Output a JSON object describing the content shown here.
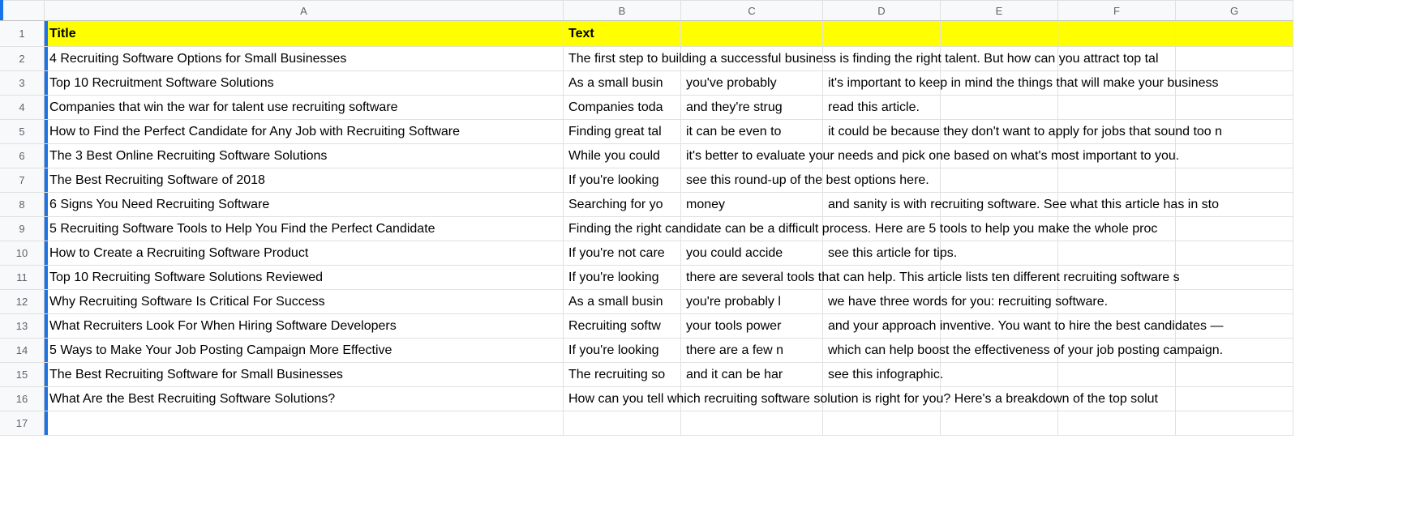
{
  "columns": [
    "A",
    "B",
    "C",
    "D",
    "E",
    "F",
    "G"
  ],
  "headers": {
    "A": "Title",
    "B": "Text"
  },
  "rows": [
    {
      "A": "4 Recruiting Software Options for Small Businesses",
      "B": "The first step to building a successful business is finding the right talent. But how can you attract top tal"
    },
    {
      "A": "Top 10 Recruitment Software Solutions",
      "B": "As a small busin",
      "C": "you've probably",
      "D": "it's important to keep in mind the things that will make your business"
    },
    {
      "A": "Companies that win the war for talent use recruiting software",
      "B": "Companies toda",
      "C": "and they're strug",
      "D": "read this article."
    },
    {
      "A": "How to Find the Perfect Candidate for Any Job with Recruiting Software",
      "B": "Finding great tal",
      "C": "it can be even to",
      "D": "it could be because they don't want to apply for jobs that sound too n"
    },
    {
      "A": "The 3 Best Online Recruiting Software Solutions",
      "B": "While you could",
      "C": "it's better to evaluate your needs and pick one based on what's most important to you."
    },
    {
      "A": "The Best Recruiting Software of 2018",
      "B": "If you're looking",
      "C": "see this round-up of the best options here."
    },
    {
      "A": "6 Signs You Need Recruiting Software",
      "B": "Searching for yo",
      "C": "money",
      "D": "and sanity is with recruiting software. See what this article has in sto"
    },
    {
      "A": "5 Recruiting Software Tools to Help You Find the Perfect Candidate",
      "B": "Finding the right candidate can be a difficult process. Here are 5 tools to help you make the whole proc"
    },
    {
      "A": "How to Create a Recruiting Software Product",
      "B": "If you're not care",
      "C": "you could accide",
      "D": "see this article for tips."
    },
    {
      "A": "Top 10 Recruiting Software Solutions Reviewed",
      "B": "If you're looking",
      "C": "there are several tools that can help. This article lists ten different recruiting software s"
    },
    {
      "A": "Why Recruiting Software Is Critical For Success",
      "B": "As a small busin",
      "C": "you're probably l",
      "D": "we have three words for you: recruiting software."
    },
    {
      "A": "What Recruiters Look For When Hiring Software Developers",
      "B": "Recruiting softw",
      "C": "your tools power",
      "D": "and your approach inventive. You want to hire the best candidates —"
    },
    {
      "A": "5 Ways to Make Your Job Posting Campaign More Effective",
      "B": "If you're looking",
      "C": "there are a few n",
      "D": "which can help boost the effectiveness of your job posting campaign."
    },
    {
      "A": "The Best Recruiting Software for Small Businesses",
      "B": "The recruiting so",
      "C": "and it can be har",
      "D": "see this infographic."
    },
    {
      "A": "What Are the Best Recruiting Software Solutions?",
      "B": "How can you tell which recruiting software solution is right for you? Here's a breakdown of the top solut"
    }
  ]
}
